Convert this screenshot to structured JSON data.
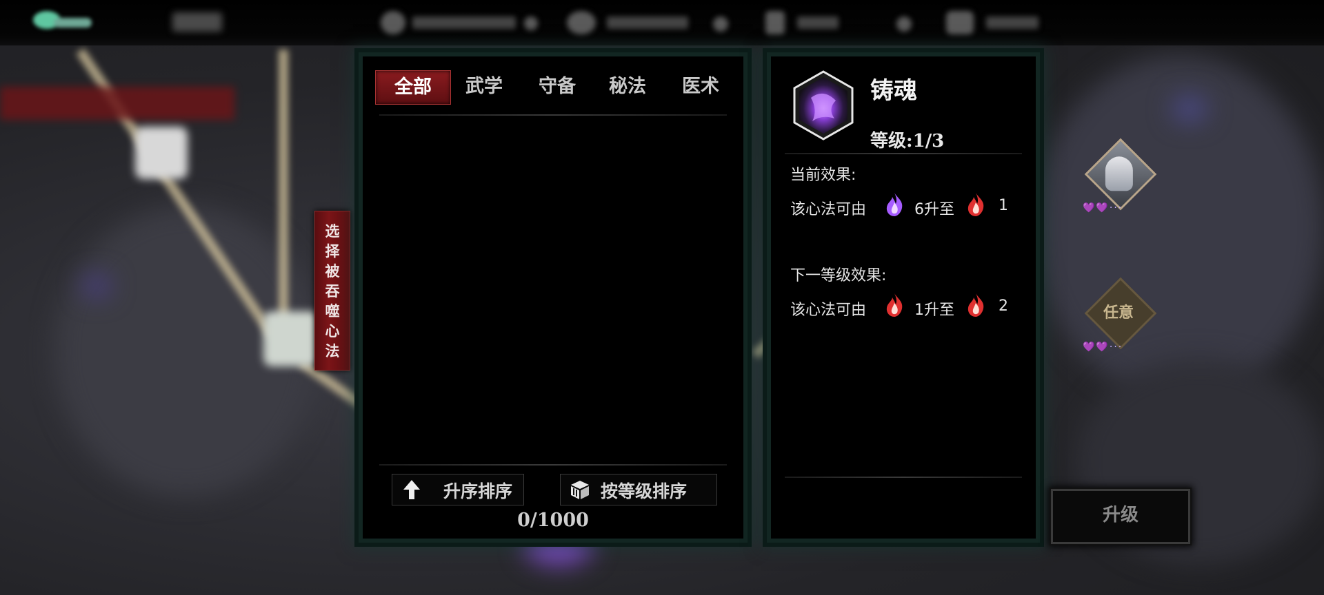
{
  "colors": {
    "panel_bg": "#000000",
    "panel_border": "#122622",
    "tab_active": "#8a1b1f",
    "purple_flame": "#a65cff",
    "red_flame": "#e03030",
    "gold": "#c9b78f"
  },
  "tabs": [
    {
      "label": "全部",
      "active": true
    },
    {
      "label": "武学",
      "active": false
    },
    {
      "label": "守备",
      "active": false
    },
    {
      "label": "秘法",
      "active": false
    },
    {
      "label": "医术",
      "active": false
    }
  ],
  "side_banner": "选\n择\n被\n吞\n噬\n心\n法",
  "sort": {
    "ascending_label": "升序排序",
    "ascending_icon": "up-arrow-icon",
    "by_level_label": "按等级排序",
    "by_level_icon": "box-icon"
  },
  "capacity": "0/1000",
  "skill": {
    "name": "铸魂",
    "level": "等级:1/3",
    "icon": "soul-forge-icon",
    "current_label": "当前效果:",
    "current": {
      "prefix": "该心法可由",
      "from_icon": "purple-flame-icon",
      "from_value": "6升至",
      "to_icon": "red-flame-icon",
      "to_value": "1"
    },
    "next_label": "下一等级效果:",
    "next": {
      "prefix": "该心法可由",
      "from_icon": "red-flame-icon",
      "from_value": "1升至",
      "to_icon": "red-flame-icon",
      "to_value": "2"
    }
  },
  "nodes": {
    "any_label": "任意"
  },
  "upgrade_label": "升级"
}
